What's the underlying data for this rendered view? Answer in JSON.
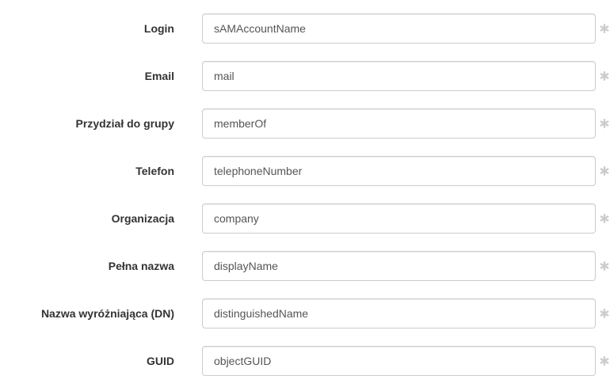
{
  "form": {
    "fields": [
      {
        "label": "Login",
        "value": "sAMAccountName"
      },
      {
        "label": "Email",
        "value": "mail"
      },
      {
        "label": "Przydział do grupy",
        "value": "memberOf"
      },
      {
        "label": "Telefon",
        "value": "telephoneNumber"
      },
      {
        "label": "Organizacja",
        "value": "company"
      },
      {
        "label": "Pełna nazwa",
        "value": "displayName"
      },
      {
        "label": "Nazwa wyróżniająca (DN)",
        "value": "distinguishedName"
      },
      {
        "label": "GUID",
        "value": "objectGUID"
      }
    ],
    "required_icon": "asterisk-icon",
    "required_icon_color": "#cccccc"
  }
}
